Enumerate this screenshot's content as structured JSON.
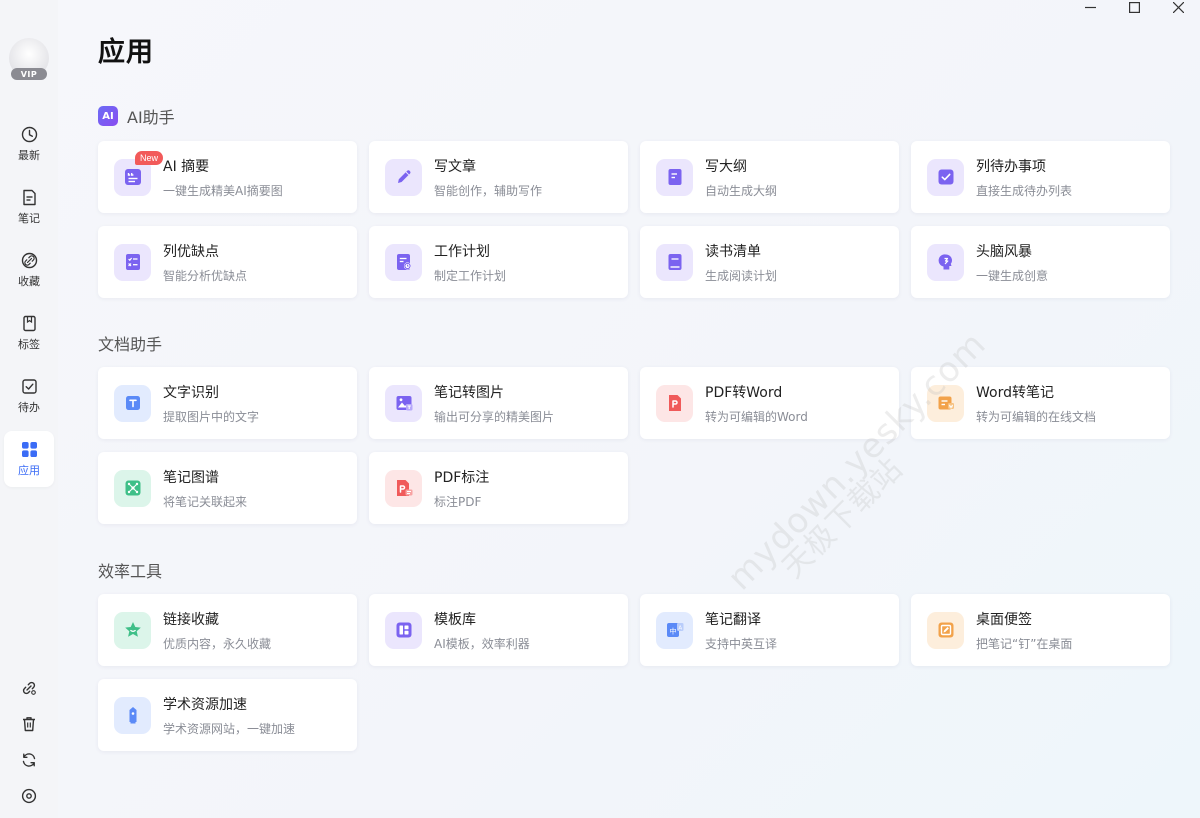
{
  "window": {
    "minimize_label": "",
    "maximize_label": "",
    "close_label": ""
  },
  "sidebar": {
    "vip_label": "VIP",
    "items": [
      {
        "label": "最新",
        "icon": "clock-icon"
      },
      {
        "label": "笔记",
        "icon": "note-icon"
      },
      {
        "label": "收藏",
        "icon": "link-icon"
      },
      {
        "label": "标签",
        "icon": "bookmark-icon"
      },
      {
        "label": "待办",
        "icon": "checkbox-icon"
      },
      {
        "label": "应用",
        "icon": "apps-grid-icon",
        "active": true
      }
    ],
    "bottom_icons": [
      "link-settings-icon",
      "trash-icon",
      "sync-icon",
      "settings-icon"
    ]
  },
  "page": {
    "title": "应用"
  },
  "sections": {
    "ai": {
      "logo_text": "AI",
      "title": "AI助手",
      "cards": [
        {
          "title": "AI 摘要",
          "desc": "一键生成精美AI摘要图",
          "badge": "New",
          "icon": "quote-doc-icon"
        },
        {
          "title": "写文章",
          "desc": "智能创作，辅助写作",
          "icon": "pencil-icon"
        },
        {
          "title": "写大纲",
          "desc": "自动生成大纲",
          "icon": "outline-doc-icon"
        },
        {
          "title": "列待办事项",
          "desc": "直接生成待办列表",
          "icon": "checkbox-icon"
        },
        {
          "title": "列优缺点",
          "desc": "智能分析优缺点",
          "icon": "pros-cons-icon"
        },
        {
          "title": "工作计划",
          "desc": "制定工作计划",
          "icon": "plan-doc-icon"
        },
        {
          "title": "读书清单",
          "desc": "生成阅读计划",
          "icon": "book-icon"
        },
        {
          "title": "头脑风暴",
          "desc": "一键生成创意",
          "icon": "brain-icon"
        }
      ]
    },
    "doc": {
      "title": "文档助手",
      "cards": [
        {
          "title": "文字识别",
          "desc": "提取图片中的文字",
          "icon": "ocr-icon"
        },
        {
          "title": "笔记转图片",
          "desc": "输出可分享的精美图片",
          "icon": "image-icon"
        },
        {
          "title": "PDF转Word",
          "desc": "转为可编辑的Word",
          "icon": "pdf-icon"
        },
        {
          "title": "Word转笔记",
          "desc": "转为可编辑的在线文档",
          "icon": "word-icon"
        },
        {
          "title": "笔记图谱",
          "desc": "将笔记关联起来",
          "icon": "graph-icon"
        },
        {
          "title": "PDF标注",
          "desc": "标注PDF",
          "icon": "pdf-annotate-icon"
        }
      ]
    },
    "tools": {
      "title": "效率工具",
      "cards": [
        {
          "title": "链接收藏",
          "desc": "优质内容，永久收藏",
          "icon": "star-icon"
        },
        {
          "title": "模板库",
          "desc": "AI模板，效率利器",
          "icon": "template-icon"
        },
        {
          "title": "笔记翻译",
          "desc": "支持中英互译",
          "icon": "translate-icon"
        },
        {
          "title": "桌面便签",
          "desc": "把笔记“钉”在桌面",
          "icon": "sticky-note-icon"
        },
        {
          "title": "学术资源加速",
          "desc": "学术资源网站，一键加速",
          "icon": "academic-icon"
        }
      ]
    }
  },
  "watermark": "mydown.yesky.com",
  "watermark_cn": "天极下载站",
  "colors": {
    "accent": "#3b6cf6",
    "purple": "#7b63f0",
    "red": "#f05a5a",
    "orange": "#f2a24a",
    "green": "#3fbf88"
  }
}
